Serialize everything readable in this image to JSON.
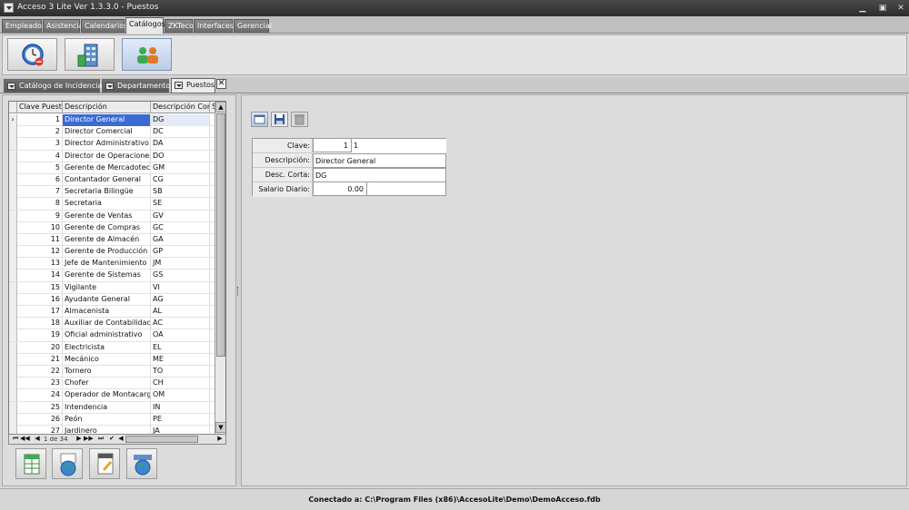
{
  "window": {
    "title": "Acceso 3 Lite Ver 1.3.3.0 - Puestos",
    "minimize": "▁",
    "restore": "▣",
    "close": "✕"
  },
  "main_tabs": [
    "Empleados",
    "Asistencia",
    "Calendarios",
    "Catálogos",
    "ZKTeco",
    "Interfaces",
    "Gerencial"
  ],
  "active_main_tab": "Catálogos",
  "sub_tabs": [
    "Catálogo de Incidencias",
    "Departamentos",
    "Puestos"
  ],
  "active_sub_tab": "Puestos",
  "sub_tab_close": "✕",
  "grid": {
    "columns": [
      "Clave Puesto",
      "Descripción",
      "Descripción Corta",
      "Sala"
    ],
    "selected_index": 0,
    "current_marker": "›",
    "rows": [
      {
        "clave": "1",
        "descripcion": "Director General",
        "corta": "DG"
      },
      {
        "clave": "2",
        "descripcion": "Director Comercial",
        "corta": "DC"
      },
      {
        "clave": "3",
        "descripcion": "Director Administrativo",
        "corta": "DA"
      },
      {
        "clave": "4",
        "descripcion": "Director de Operaciones",
        "corta": "DO"
      },
      {
        "clave": "5",
        "descripcion": "Gerente de Mercadotecnia",
        "corta": "GM"
      },
      {
        "clave": "6",
        "descripcion": "Contantador General",
        "corta": "CG"
      },
      {
        "clave": "7",
        "descripcion": "Secretaria Bilingüe",
        "corta": "SB"
      },
      {
        "clave": "8",
        "descripcion": "Secretaria",
        "corta": "SE"
      },
      {
        "clave": "9",
        "descripcion": "Gerente de Ventas",
        "corta": "GV"
      },
      {
        "clave": "10",
        "descripcion": "Gerente de Compras",
        "corta": "GC"
      },
      {
        "clave": "11",
        "descripcion": "Gerente de Almacén",
        "corta": "GA"
      },
      {
        "clave": "12",
        "descripcion": "Gerente de Producción",
        "corta": "GP"
      },
      {
        "clave": "13",
        "descripcion": "Jefe de Mantenimiento",
        "corta": "JM"
      },
      {
        "clave": "14",
        "descripcion": "Gerente de Sistemas",
        "corta": "GS"
      },
      {
        "clave": "15",
        "descripcion": "Vigilante",
        "corta": "VI"
      },
      {
        "clave": "16",
        "descripcion": "Ayudante General",
        "corta": "AG"
      },
      {
        "clave": "17",
        "descripcion": "Almacenista",
        "corta": "AL"
      },
      {
        "clave": "18",
        "descripcion": "Auxiliar de Contabilidad",
        "corta": "AC"
      },
      {
        "clave": "19",
        "descripcion": "Oficial administrativo",
        "corta": "OA"
      },
      {
        "clave": "20",
        "descripcion": "Electricista",
        "corta": "EL"
      },
      {
        "clave": "21",
        "descripcion": "Mecánico",
        "corta": "ME"
      },
      {
        "clave": "22",
        "descripcion": "Tornero",
        "corta": "TO"
      },
      {
        "clave": "23",
        "descripcion": "Chofer",
        "corta": "CH"
      },
      {
        "clave": "24",
        "descripcion": "Operador de Montacargas",
        "corta": "OM"
      },
      {
        "clave": "25",
        "descripcion": "Intendencia",
        "corta": "IN"
      },
      {
        "clave": "26",
        "descripcion": "Peón",
        "corta": "PE"
      },
      {
        "clave": "27",
        "descripcion": "Jardinero",
        "corta": "JA"
      }
    ]
  },
  "navigator": {
    "first": "⏮",
    "prev_page": "◀◀",
    "prev": "◀",
    "position": "1 de 34",
    "next": "▶",
    "next_page": "▶▶",
    "last": "⏭",
    "confirm": "✔"
  },
  "scroll": {
    "up": "▲",
    "down": "▼",
    "left": "◀",
    "right": "▶"
  },
  "form": {
    "labels": {
      "clave": "Clave:",
      "descripcion": "Descripción:",
      "corta": "Desc. Corta:",
      "salario": "Salario Diario:"
    },
    "values": {
      "clave": "1",
      "clave_extra": "1",
      "descripcion": "Director General",
      "corta": "DG",
      "salario": "0.00"
    }
  },
  "status": "Conectado a: C:\\Program Files (x86)\\AccesoLite\\Demo\\DemoAcceso.fdb",
  "colors": {
    "selection": "#3a6ad4",
    "titlebar": "#2c2c2c"
  }
}
